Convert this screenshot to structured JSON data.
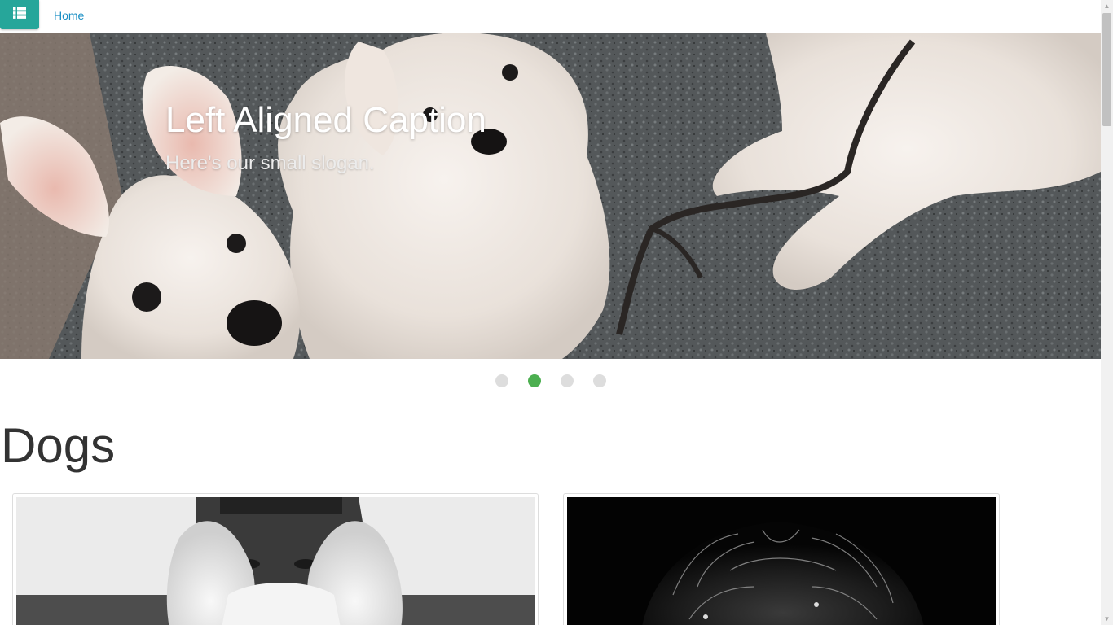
{
  "navbar": {
    "menu_icon": "list-icon",
    "home_label": "Home",
    "accent_color": "#26a69a",
    "link_color": "#1a8fc4"
  },
  "carousel": {
    "caption_title": "Left Aligned Caption",
    "caption_subtitle": "Here's our small slogan.",
    "slide_count": 4,
    "active_index": 1,
    "active_color": "#4caf50",
    "inactive_color": "#dddddd"
  },
  "section": {
    "title": "Dogs"
  },
  "cards": [
    {
      "image": "grayscale photo of person behind white dog"
    },
    {
      "image": "grayscale photo of shaggy dark dog"
    }
  ]
}
